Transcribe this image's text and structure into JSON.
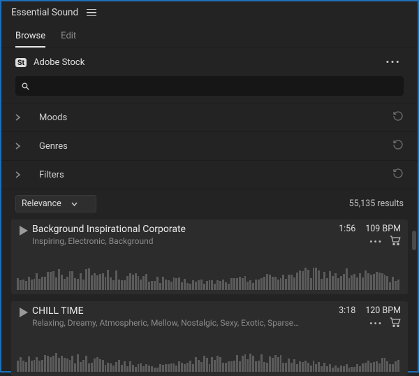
{
  "panel": {
    "title": "Essential Sound"
  },
  "tabs": {
    "browse": "Browse",
    "edit": "Edit"
  },
  "source": {
    "badge": "St",
    "label": "Adobe Stock"
  },
  "search": {
    "placeholder": ""
  },
  "filterSections": {
    "moods": "Moods",
    "genres": "Genres",
    "filters": "Filters"
  },
  "sort": {
    "selected": "Relevance",
    "resultsCount": "55,135 results"
  },
  "tracks": [
    {
      "title": "Background Inspirational Corporate",
      "tags": "Inspiring, Electronic, Background",
      "duration": "1:56",
      "bpm": "109 BPM"
    },
    {
      "title": "CHILL TIME",
      "tags": "Relaxing, Dreamy, Atmospheric, Mellow, Nostalgic, Sexy, Exotic, Sparse…",
      "duration": "3:18",
      "bpm": "120 BPM"
    }
  ]
}
